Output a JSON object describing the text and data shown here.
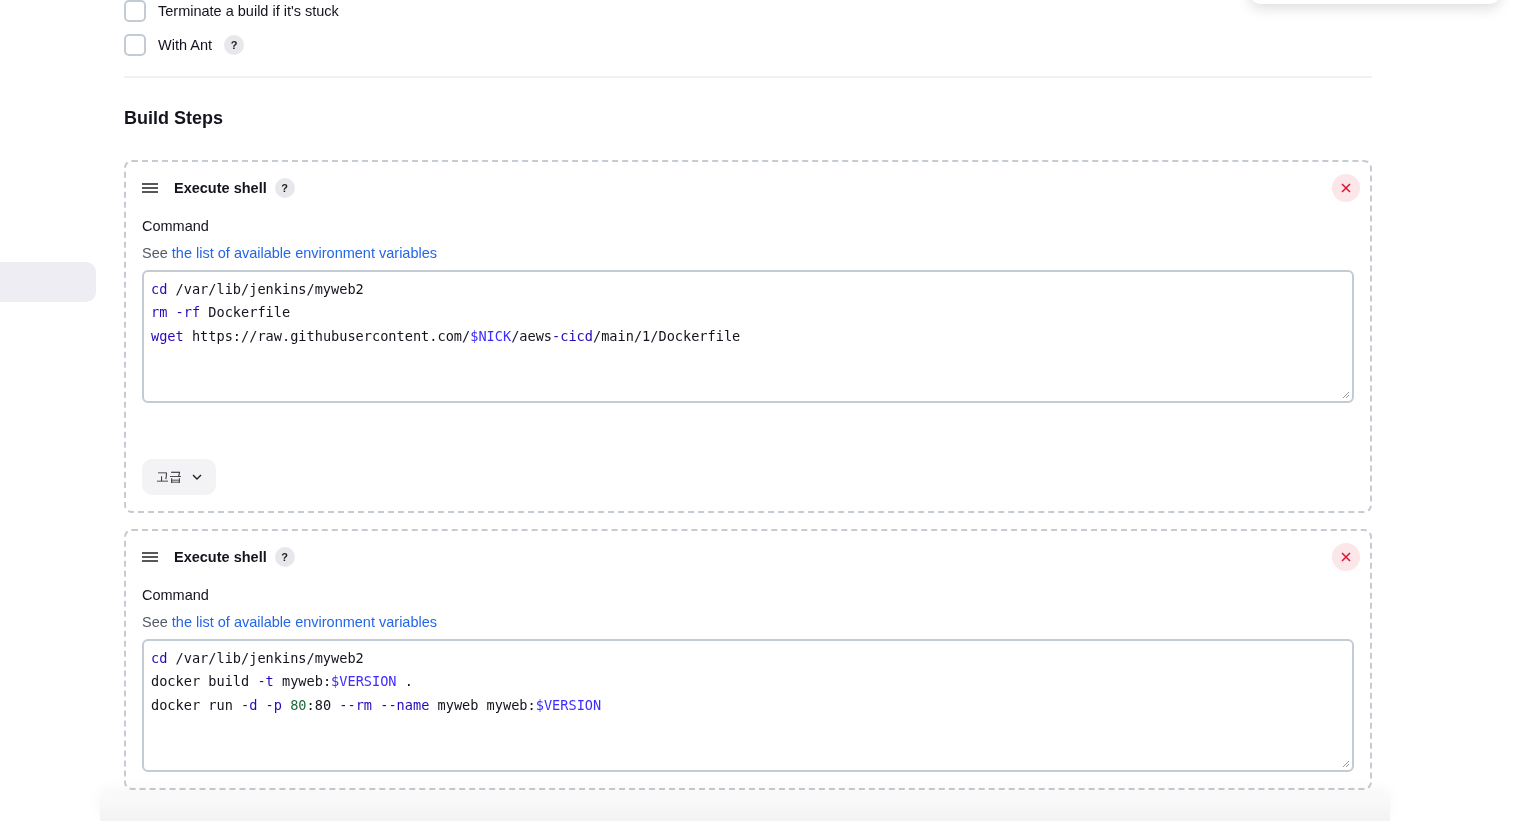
{
  "options": [
    {
      "label": "Terminate a build if it's stuck",
      "checked": false
    },
    {
      "label": "With Ant",
      "checked": false,
      "help": "?"
    }
  ],
  "section_title": "Build Steps",
  "steps": [
    {
      "title": "Execute shell",
      "help": "?",
      "field_label": "Command",
      "hint_prefix": "See",
      "hint_link": "the list of available environment variables",
      "advanced_button": "고급",
      "lines": [
        [
          {
            "text": "cd",
            "kind": "keyword"
          },
          {
            "text": " /var/lib/jenkins/myweb2",
            "kind": "plain"
          }
        ],
        [
          {
            "text": "rm",
            "kind": "keyword"
          },
          {
            "text": " -rf",
            "kind": "keyword"
          },
          {
            "text": " Dockerfile",
            "kind": "plain"
          }
        ],
        [
          {
            "text": "wget",
            "kind": "keyword"
          },
          {
            "text": " https://raw.githubusercontent.com/",
            "kind": "plain"
          },
          {
            "text": "$NICK",
            "kind": "variable"
          },
          {
            "text": "/aews",
            "kind": "plain"
          },
          {
            "text": "-cicd",
            "kind": "keyword"
          },
          {
            "text": "/main/1/Dockerfile",
            "kind": "plain"
          }
        ]
      ]
    },
    {
      "title": "Execute shell",
      "help": "?",
      "field_label": "Command",
      "hint_prefix": "See",
      "hint_link": "the list of available environment variables",
      "lines": [
        [
          {
            "text": "cd",
            "kind": "keyword"
          },
          {
            "text": " /var/lib/jenkins/myweb2",
            "kind": "plain"
          }
        ],
        [
          {
            "text": "docker build ",
            "kind": "plain"
          },
          {
            "text": "-t",
            "kind": "keyword"
          },
          {
            "text": " myweb:",
            "kind": "plain"
          },
          {
            "text": "$VERSION",
            "kind": "variable"
          },
          {
            "text": " .",
            "kind": "plain"
          }
        ],
        [
          {
            "text": "docker run ",
            "kind": "plain"
          },
          {
            "text": "-d",
            "kind": "keyword"
          },
          {
            "text": " -p",
            "kind": "keyword"
          },
          {
            "text": " 80",
            "kind": "number"
          },
          {
            "text": ":80 ",
            "kind": "plain"
          },
          {
            "text": "--rm",
            "kind": "keyword"
          },
          {
            "text": " --name",
            "kind": "keyword"
          },
          {
            "text": " myweb myweb:",
            "kind": "plain"
          },
          {
            "text": "$VERSION",
            "kind": "variable"
          }
        ]
      ]
    }
  ]
}
